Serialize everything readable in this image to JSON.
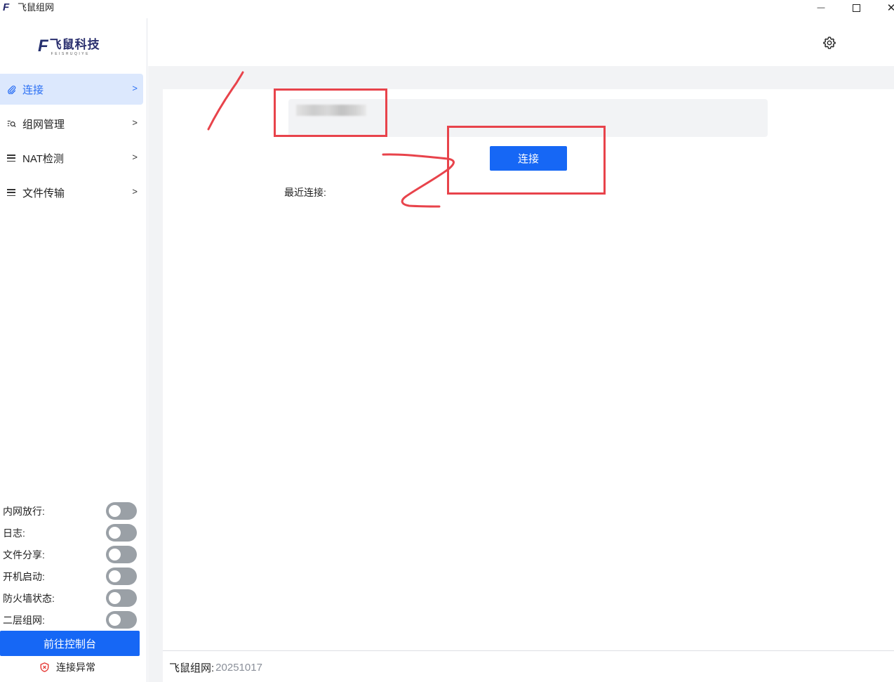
{
  "window": {
    "icon_glyph": "F",
    "title": "飞鼠组网",
    "controls": {
      "minimize": "—",
      "close": "✕"
    }
  },
  "sidebar": {
    "logo": {
      "mark": "F",
      "text": "飞鼠科技",
      "subtext": "FEISHUQIYE"
    },
    "nav": [
      {
        "label": "连接",
        "icon": "paperclip-icon",
        "arrow": ">",
        "active": true
      },
      {
        "label": "组网管理",
        "icon": "network-search-icon",
        "arrow": ">",
        "active": false
      },
      {
        "label": "NAT检测",
        "icon": "menu-icon",
        "arrow": ">",
        "active": false
      },
      {
        "label": "文件传输",
        "icon": "menu-icon",
        "arrow": ">",
        "active": false
      }
    ],
    "toggles": [
      {
        "label": "内网放行:",
        "on": false
      },
      {
        "label": "日志:",
        "on": false
      },
      {
        "label": "文件分享:",
        "on": false
      },
      {
        "label": "开机启动:",
        "on": false
      },
      {
        "label": "防火墙状态:",
        "on": false
      },
      {
        "label": "二层组网:",
        "on": false
      }
    ],
    "console_button": "前往控制台",
    "status": {
      "icon": "shield-alert-icon",
      "text": "连接异常"
    }
  },
  "header": {
    "settings_icon": "gear-icon"
  },
  "main": {
    "address_input": {
      "value": "",
      "placeholder": ""
    },
    "connect_button": "连接",
    "recent_label": "最近连接:"
  },
  "footer": {
    "label": "飞鼠组网:",
    "version": "20251017"
  },
  "colors": {
    "primary": "#1667f5",
    "active_bg": "#dce8fd",
    "active_text": "#2a6ff4",
    "annotation": "#e8434b",
    "main_bg": "#f2f3f5"
  }
}
